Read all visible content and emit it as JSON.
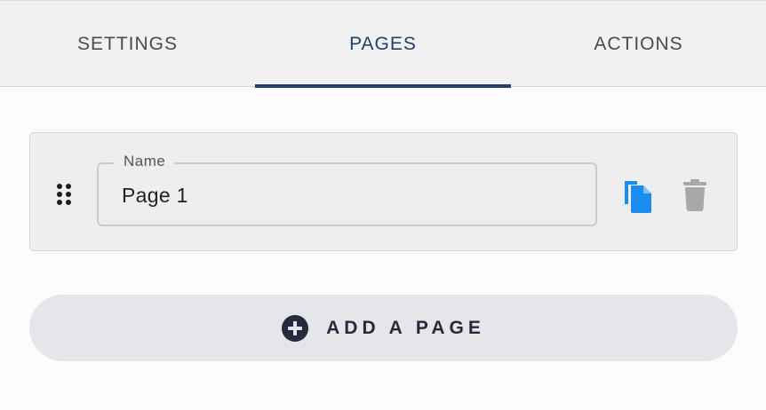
{
  "tabs": [
    {
      "label": "SETTINGS",
      "active": false
    },
    {
      "label": "PAGES",
      "active": true
    },
    {
      "label": "ACTIONS",
      "active": false
    }
  ],
  "page_card": {
    "name_label": "Name",
    "name_value": "Page 1",
    "icons": {
      "drag": "drag-handle-icon",
      "copy": "copy-icon",
      "delete": "trash-icon"
    }
  },
  "add_page": {
    "label": "ADD A PAGE",
    "icon": "plus-circle-icon"
  },
  "colors": {
    "active_tab": "#23406b",
    "copy_icon": "#1a8cf0",
    "delete_icon": "#a8a8a8",
    "add_button_bg": "#e6e6ea",
    "add_button_text": "#272a3d"
  }
}
